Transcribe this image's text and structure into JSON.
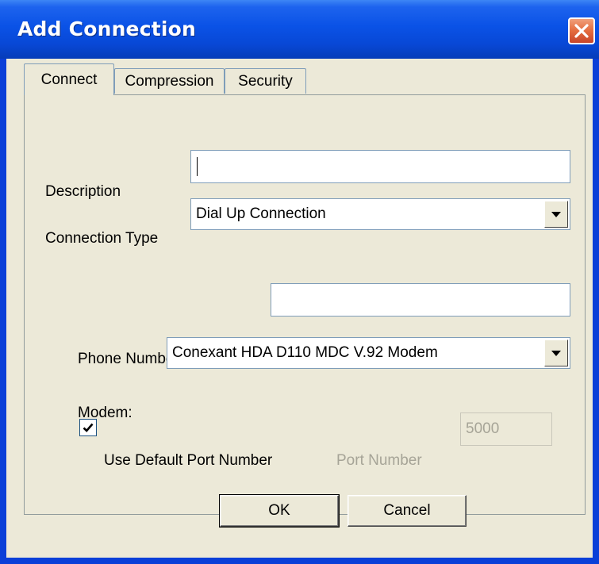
{
  "window": {
    "title": "Add Connection",
    "close_icon": "close-icon",
    "accent_color": "#0a52e6",
    "close_color": "#e46b3e"
  },
  "tabs": [
    {
      "label": "Connect",
      "active": true
    },
    {
      "label": "Compression",
      "active": false
    },
    {
      "label": "Security",
      "active": false
    }
  ],
  "form": {
    "description_label": "Description",
    "description_value": "",
    "connection_type_label": "Connection Type",
    "connection_type_value": "Dial Up Connection",
    "phone_number_label": "Phone Number",
    "phone_number_value": "",
    "modem_label": "Modem:",
    "modem_value": "Conexant HDA D110 MDC V.92 Modem",
    "use_default_port_label": "Use Default Port Number",
    "use_default_port_checked": true,
    "port_number_label": "Port Number",
    "port_number_value": "5000",
    "port_number_enabled": false
  },
  "buttons": {
    "ok_label": "OK",
    "cancel_label": "Cancel"
  }
}
